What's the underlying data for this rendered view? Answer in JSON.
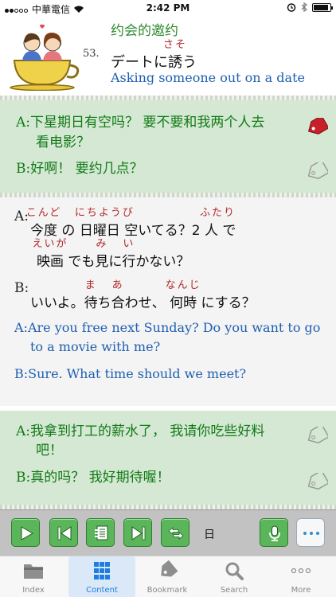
{
  "status_bar": {
    "carrier": "中華電信",
    "time": "2:42 PM"
  },
  "lesson": {
    "number": "53.",
    "title_cn": "约会的邀约",
    "title_jp_pre": "デートに",
    "title_jp_kanji": "誘",
    "title_jp_kanji_ruby": "さそ",
    "title_jp_post": "う",
    "title_en": "Asking someone out on a date"
  },
  "card1": {
    "a_speaker": "A:",
    "a_line1": "下星期日有空吗？ 要不要和我两个人去",
    "a_line2": "看电影？",
    "b_speaker": "B:",
    "b_line": "好啊！ 要约几点？"
  },
  "detail": {
    "a_speaker": "A:",
    "jp_a1": [
      {
        "text": "今度",
        "ruby": "こんど"
      },
      {
        "text": " の "
      },
      {
        "text": "日曜日",
        "ruby": "にちようび"
      },
      {
        "text": " 空いてる？2 "
      },
      {
        "text": "人",
        "ruby": "ふたり"
      },
      {
        "text": " で"
      }
    ],
    "jp_a2": [
      {
        "text": "映画",
        "ruby": "えいが"
      },
      {
        "text": " でも"
      },
      {
        "text": "見",
        "ruby": "み"
      },
      {
        "text": "に"
      },
      {
        "text": "行",
        "ruby": "い"
      },
      {
        "text": "かない？"
      }
    ],
    "b_speaker": "B:",
    "jp_b": [
      {
        "text": "いいよ。"
      },
      {
        "text": "待",
        "ruby": "ま"
      },
      {
        "text": "ち"
      },
      {
        "text": "合",
        "ruby": "あ"
      },
      {
        "text": "わせ、 "
      },
      {
        "text": "何時",
        "ruby": "なんじ"
      },
      {
        "text": " にする？"
      }
    ],
    "en_a_line1": "A:Are you free next Sunday? Do you want to go",
    "en_a_line2": "to a movie with me?",
    "en_b_line": "B:Sure. What time should we meet?"
  },
  "card2": {
    "a_speaker": "A:",
    "a_line1": "我拿到打工的薪水了， 我请你吃些好料",
    "a_line2": "吧！",
    "b_speaker": "B:",
    "b_line": "真的吗？ 我好期待喔！"
  },
  "toolbar": {
    "language_label": "日"
  },
  "tabbar": {
    "tabs": [
      {
        "label": "Index"
      },
      {
        "label": "Content"
      },
      {
        "label": "Bookmark"
      },
      {
        "label": "Search"
      },
      {
        "label": "More"
      }
    ]
  },
  "colors": {
    "accent_green": "#117a17",
    "english_blue": "#1f5fb0",
    "ruby_red": "#b3272b",
    "card_bg": "#d5e8d3",
    "tab_active": "#1e7de0"
  }
}
